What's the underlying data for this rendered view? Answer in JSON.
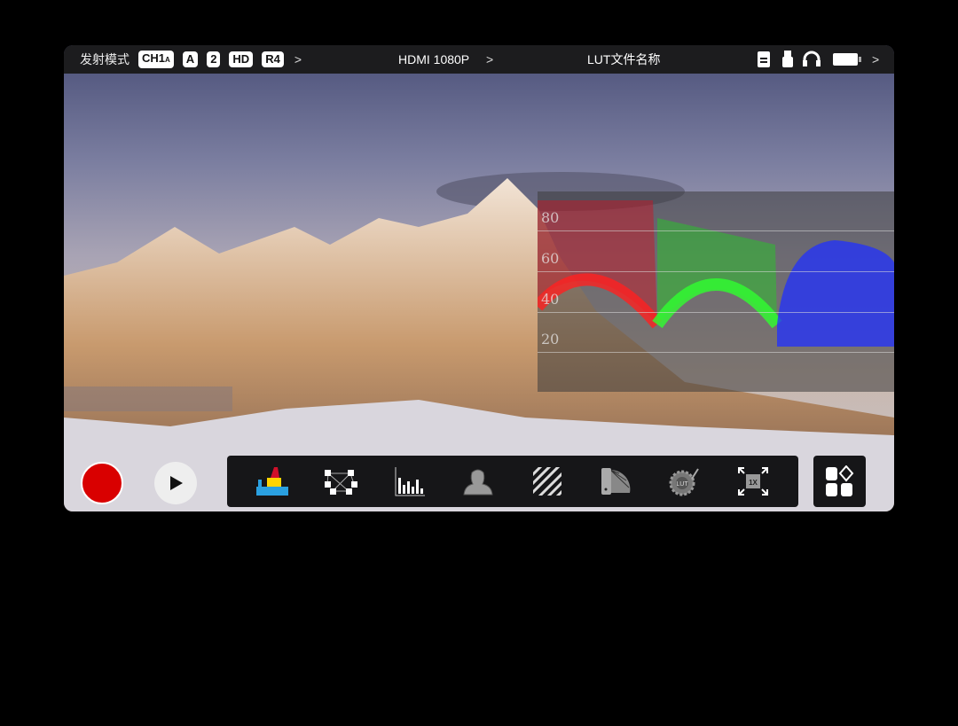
{
  "topbar": {
    "mode_label": "发射模式",
    "badges": [
      "CH1",
      "A",
      "2",
      "HD",
      "R4"
    ],
    "ch1_sub": "A",
    "signal": "HDMI 1080P",
    "lut_name": "LUT文件名称",
    "status_icons": [
      "sd-card-icon",
      "usb-icon",
      "headphones-icon",
      "battery-icon"
    ]
  },
  "waveform": {
    "levels": [
      "80",
      "60",
      "40",
      "20"
    ],
    "colors": {
      "red": "#ff2020",
      "green": "#30ff30",
      "blue": "#2030ff"
    }
  },
  "controls": {
    "record_color": "#d90000"
  },
  "toolbar": {
    "tools": [
      "waveform-icon",
      "focus-points-icon",
      "histogram-icon",
      "false-color-icon",
      "zebra-icon",
      "color-swatch-icon",
      "lut-icon",
      "zoom-1x-icon"
    ],
    "zoom_label": "1X",
    "lut_label": "LUT"
  },
  "more_button": "apps-icon"
}
